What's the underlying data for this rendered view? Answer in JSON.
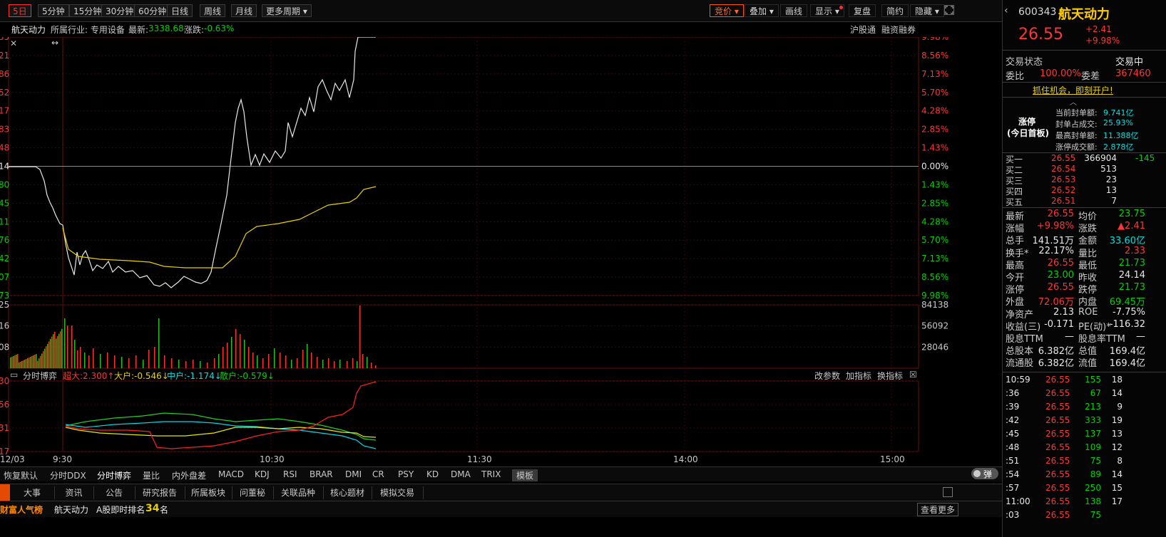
{
  "toolbar": {
    "periods": [
      {
        "label": "5日",
        "active": true
      },
      {
        "label": "5分钟"
      },
      {
        "label": "15分钟"
      },
      {
        "label": "30分钟"
      },
      {
        "label": "60分钟"
      },
      {
        "label": "日线"
      },
      {
        "label": "周线"
      },
      {
        "label": "月线"
      },
      {
        "label": "更多周期 ▾"
      }
    ],
    "right": [
      "竞价 ▾",
      "叠加 ▾",
      "画线",
      "显示 ▾",
      "复盘",
      "简约",
      "隐藏 ▾"
    ]
  },
  "info": {
    "name": "航天动力",
    "industry": "所属行业: 专用设备",
    "latest_label": "最新:",
    "latest": "3338.68",
    "change_label": "涨跌:",
    "change": "-0.63%",
    "tags": [
      "沪股通",
      "融资融券"
    ]
  },
  "chart_data": {
    "type": "line",
    "price_axis_left": [
      "55",
      "21",
      "86",
      "52",
      "17",
      "83",
      "48",
      "14",
      "80",
      "45",
      "11",
      "76",
      "42",
      "07",
      "73"
    ],
    "pct_axis_right": [
      "9.98%",
      "8.56%",
      "7.13%",
      "5.70%",
      "4.28%",
      "2.85%",
      "1.43%",
      "0.00%",
      "1.43%",
      "2.85%",
      "4.28%",
      "5.70%",
      "7.13%",
      "8.56%",
      "9.98%"
    ],
    "volume_axis_right": [
      "84138",
      "56092",
      "28046"
    ],
    "volume_axis_left": [
      "25",
      "16",
      "08"
    ],
    "flow_axis_left": [
      "30",
      "56",
      "31",
      "17"
    ],
    "x_ticks": [
      "12/03",
      "9:30",
      "10:30",
      "11:30",
      "14:00",
      "15:00"
    ],
    "colors": {
      "price": "#e8e8e8",
      "avg": "#e8d000",
      "super": "#ff2020",
      "big": "#e8e800",
      "mid": "#00d8e8",
      "small": "#20d020",
      "vol_up": "#ff3030",
      "vol_down": "#20c020"
    },
    "flow_indicator": {
      "name": "分时博弈",
      "super": "超大:2.300↑",
      "big": "大户:-0.546↓",
      "mid": "中户:-1.174↓",
      "small": "散户:-0.579↓",
      "actions": [
        "改参数",
        "加指标",
        "换指标"
      ]
    }
  },
  "indicator_tabs": [
    "恢复默认",
    "分时DDX",
    "分时博弈",
    "量比",
    "内外盘差",
    "MACD",
    "KDJ",
    "RSI",
    "BRAR",
    "DMI",
    "CR",
    "PSY",
    "KD",
    "DMA",
    "TRIX",
    "模板"
  ],
  "toggle_label": "弹",
  "bottom_tabs": [
    "大事",
    "资讯",
    "公告",
    "研究报告",
    "所属板块",
    "问董秘",
    "关联品种",
    "核心题材",
    "模拟交易"
  ],
  "footer": {
    "brand": "财富人气榜",
    "stock": "航天动力",
    "rank_label": "A股即时排名",
    "rank": "34",
    "rank_unit": "名",
    "more": "查看更多"
  },
  "quote": {
    "code": "600343",
    "name": "航天动力",
    "price": "26.55",
    "change": "+2.41",
    "change_pct": "+9.98%",
    "status_label": "交易状态",
    "status": "交易中",
    "ratio_label": "委比",
    "ratio": "100.00%",
    "diff_label": "委差",
    "diff": "367460",
    "promo": "抓住机会，即刻开户!",
    "limit_title": "涨停",
    "limit_sub": "(今日首板)",
    "limit_rows": [
      {
        "k": "当前封单额:",
        "v": "9.741亿"
      },
      {
        "k": "封单占成交:",
        "v": "25.93%"
      },
      {
        "k": "最高封单额:",
        "v": "11.388亿"
      },
      {
        "k": "涨停成交额:",
        "v": "2.878亿"
      }
    ],
    "bids": [
      {
        "label": "买一",
        "price": "26.55",
        "vol": "366904",
        "delta": "-145"
      },
      {
        "label": "买二",
        "price": "26.54",
        "vol": "513",
        "delta": ""
      },
      {
        "label": "买三",
        "price": "26.53",
        "vol": "23",
        "delta": ""
      },
      {
        "label": "买四",
        "price": "26.52",
        "vol": "13",
        "delta": ""
      },
      {
        "label": "买五",
        "price": "26.51",
        "vol": "7",
        "delta": ""
      }
    ],
    "stats": [
      {
        "l1": "最新",
        "v1": "26.55",
        "c1": "red",
        "l2": "均价",
        "v2": "23.75",
        "c2": "green"
      },
      {
        "l1": "涨幅",
        "v1": "+9.98%",
        "c1": "red",
        "l2": "涨跌",
        "v2": "▲2.41",
        "c2": "red"
      },
      {
        "l1": "总手",
        "v1": "141.51万",
        "c1": "white",
        "l2": "金额",
        "v2": "33.60亿",
        "c2": "cyan"
      },
      {
        "l1": "换手*",
        "v1": "22.17%",
        "c1": "white",
        "l2": "量比",
        "v2": "2.33",
        "c2": "red"
      },
      {
        "l1": "最高",
        "v1": "26.55",
        "c1": "red",
        "l2": "最低",
        "v2": "21.73",
        "c2": "green"
      },
      {
        "l1": "今开",
        "v1": "23.00",
        "c1": "green",
        "l2": "昨收",
        "v2": "24.14",
        "c2": "white"
      },
      {
        "l1": "涨停",
        "v1": "26.55",
        "c1": "red",
        "l2": "跌停",
        "v2": "21.73",
        "c2": "green"
      },
      {
        "l1": "外盘",
        "v1": "72.06万",
        "c1": "red",
        "l2": "内盘",
        "v2": "69.45万",
        "c2": "green"
      },
      {
        "l1": "净资产",
        "v1": "2.13",
        "c1": "white",
        "l2": "ROE",
        "v2": "-7.75%",
        "c2": "white"
      },
      {
        "l1": "收益(三)",
        "v1": "-0.171",
        "c1": "white",
        "l2": "PE(动)*",
        "v2": "-116.32",
        "c2": "white"
      },
      {
        "l1": "股息TTM",
        "v1": "—",
        "c1": "white",
        "l2": "股息率TTM",
        "v2": "—",
        "c2": "white"
      },
      {
        "l1": "总股本",
        "v1": "6.382亿",
        "c1": "white",
        "l2": "总值",
        "v2": "169.4亿",
        "c2": "white"
      },
      {
        "l1": "流通股",
        "v1": "6.382亿",
        "c1": "white",
        "l2": "流值",
        "v2": "169.4亿",
        "c2": "white"
      }
    ],
    "ticks": [
      {
        "t": "10:59",
        "p": "26.55",
        "v": "155",
        "n": "18"
      },
      {
        "t": ":36",
        "p": "26.55",
        "v": "67",
        "n": "14"
      },
      {
        "t": ":39",
        "p": "26.55",
        "v": "213",
        "n": "9"
      },
      {
        "t": ":42",
        "p": "26.55",
        "v": "333",
        "n": "19"
      },
      {
        "t": ":45",
        "p": "26.55",
        "v": "137",
        "n": "13"
      },
      {
        "t": ":48",
        "p": "26.55",
        "v": "109",
        "n": "12"
      },
      {
        "t": ":51",
        "p": "26.55",
        "v": "75",
        "n": "8"
      },
      {
        "t": ":54",
        "p": "26.55",
        "v": "89",
        "n": "14"
      },
      {
        "t": ":57",
        "p": "26.55",
        "v": "250",
        "n": "15"
      },
      {
        "t": "11:00",
        "p": "26.55",
        "v": "138",
        "n": "17"
      },
      {
        "t": ":03",
        "p": "26.55",
        "v": "75",
        "n": ""
      }
    ]
  }
}
